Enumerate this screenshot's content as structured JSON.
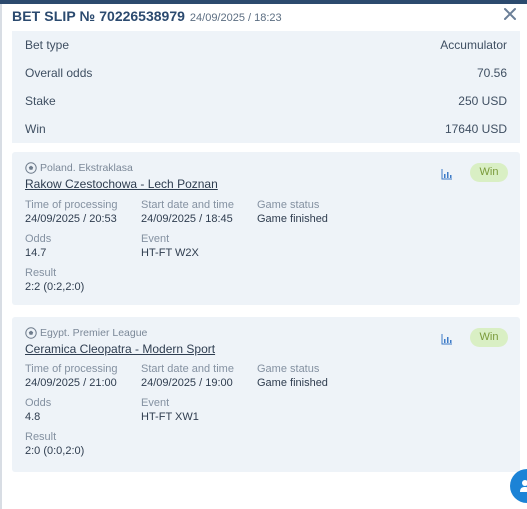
{
  "header": {
    "slip_label": "BET SLIP №",
    "slip_number": "70226538979",
    "datetime": "24/09/2025 / 18:23"
  },
  "summary": [
    {
      "label": "Bet type",
      "value": "Accumulator"
    },
    {
      "label": "Overall odds",
      "value": "70.56"
    },
    {
      "label": "Stake",
      "value": "250 USD"
    },
    {
      "label": "Win",
      "value": "17640 USD"
    }
  ],
  "bets": [
    {
      "league": "Poland. Ekstraklasa",
      "match": "Rakow Czestochowa - Lech Poznan",
      "status_badge": "Win",
      "time_processing_label": "Time of processing",
      "time_processing": "24/09/2025 / 20:53",
      "start_label": "Start date and time",
      "start": "24/09/2025 / 18:45",
      "game_status_label": "Game status",
      "game_status": "Game finished",
      "odds_label": "Odds",
      "odds": "14.7",
      "event_label": "Event",
      "event": "HT-FT W2X",
      "result_label": "Result",
      "result": "2:2 (0:2,2:0)"
    },
    {
      "league": "Egypt. Premier League",
      "match": "Ceramica Cleopatra - Modern Sport",
      "status_badge": "Win",
      "time_processing_label": "Time of processing",
      "time_processing": "24/09/2025 / 21:00",
      "start_label": "Start date and time",
      "start": "24/09/2025 / 19:00",
      "game_status_label": "Game status",
      "game_status": "Game finished",
      "odds_label": "Odds",
      "odds": "4.8",
      "event_label": "Event",
      "event": "HT-FT XW1",
      "result_label": "Result",
      "result": "2:0 (0:0,2:0)"
    }
  ],
  "icons": {
    "close": "close-icon",
    "sport": "football-icon",
    "stats": "bar-chart-icon",
    "support": "support-chat-icon"
  },
  "colors": {
    "header_text": "#2b4a6f",
    "card_bg": "#eef3f8",
    "win_badge_bg": "#d9efc4",
    "win_badge_text": "#7a9a3a",
    "fab_bg": "#1c83d6"
  }
}
